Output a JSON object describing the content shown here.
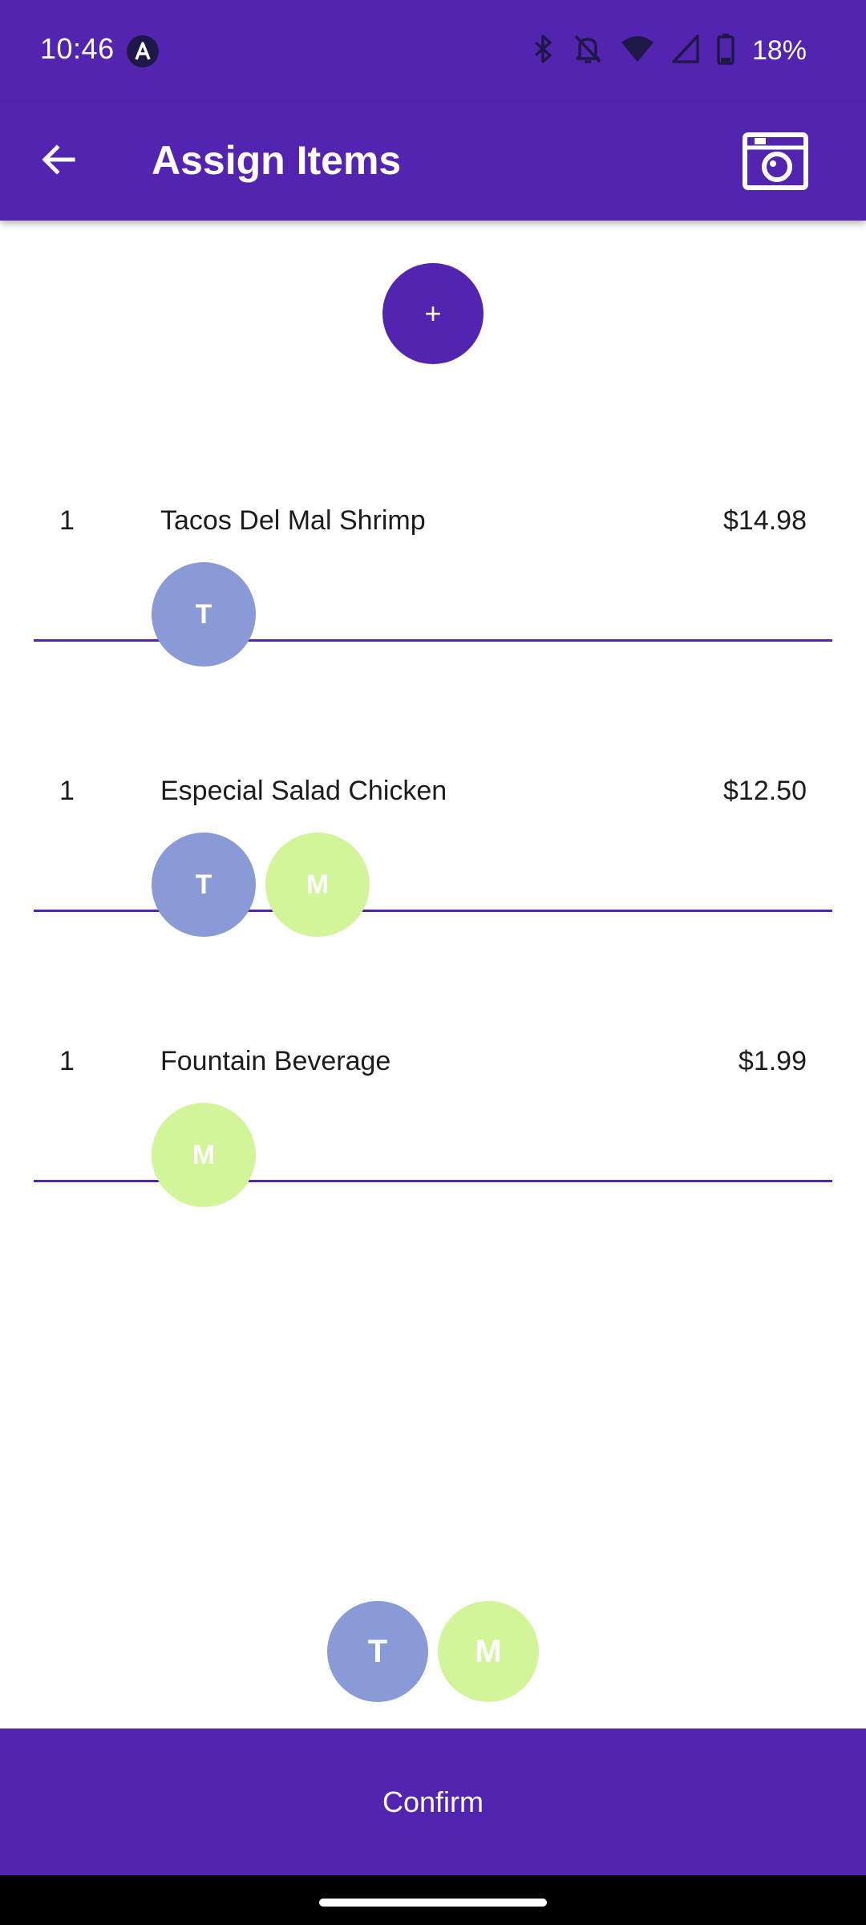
{
  "status_bar": {
    "time": "10:46",
    "battery_text": "18%",
    "icons": [
      "app-notification-icon",
      "bluetooth-icon",
      "bell-off-icon",
      "wifi-icon",
      "cellular-signal-icon",
      "battery-icon"
    ]
  },
  "app_bar": {
    "title": "Assign Items",
    "back_icon": "arrow-left-icon",
    "camera_icon": "camera-icon"
  },
  "add_button": {
    "label": "+"
  },
  "items": [
    {
      "quantity": "1",
      "name": "Tacos Del Mal Shrimp",
      "price": "$14.98",
      "assignees": [
        {
          "initial": "T",
          "color": "#8a9ad6"
        }
      ]
    },
    {
      "quantity": "1",
      "name": "Especial Salad Chicken",
      "price": "$12.50",
      "assignees": [
        {
          "initial": "T",
          "color": "#8a9ad6"
        },
        {
          "initial": "M",
          "color": "#d2f59a"
        }
      ]
    },
    {
      "quantity": "1",
      "name": "Fountain Beverage",
      "price": "$1.99",
      "assignees": [
        {
          "initial": "M",
          "color": "#d2f59a"
        }
      ]
    }
  ],
  "people": [
    {
      "initial": "T",
      "color": "#8a9ad6"
    },
    {
      "initial": "M",
      "color": "#d2f59a"
    }
  ],
  "confirm": {
    "label": "Confirm"
  },
  "colors": {
    "primary": "#5324b0",
    "background": "#ffffff",
    "text": "#1c1c1c"
  }
}
